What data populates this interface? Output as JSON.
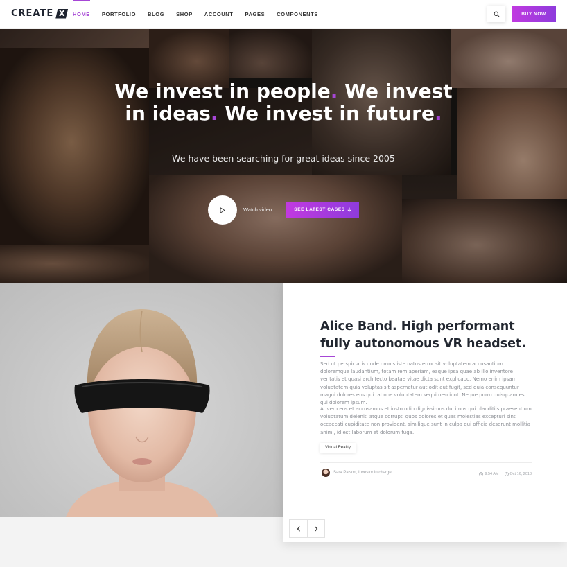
{
  "brand": {
    "name": "CREATE",
    "mark": "X"
  },
  "nav": [
    {
      "label": "HOME"
    },
    {
      "label": "PORTFOLIO"
    },
    {
      "label": "BLOG"
    },
    {
      "label": "SHOP"
    },
    {
      "label": "ACCOUNT"
    },
    {
      "label": "PAGES"
    },
    {
      "label": "COMPONENTS"
    }
  ],
  "header": {
    "buy_label": "BUY NOW",
    "search_icon": "search-icon"
  },
  "hero": {
    "title_part1": "We invest in people",
    "title_part2": " We invest in ideas",
    "title_part3": " We invest in future",
    "dot": ".",
    "subtitle": "We have been searching for great ideas since 2005",
    "watch_label": "Watch video",
    "cases_label": "SEE LATEST CASES",
    "cases_icon": "arrow-down-icon",
    "play_icon": "play-icon"
  },
  "article": {
    "title": "Alice Band. High performant fully autonomous VR headset.",
    "paragraph1": "Sed ut perspiciatis unde omnis iste natus error sit voluptatem accusantium doloremque laudantium, totam rem aperiam, eaque ipsa quae ab illo inventore veritatis et quasi architecto beatae vitae dicta sunt explicabo. Nemo enim ipsam voluptatem quia voluptas sit aspernatur aut odit aut fugit, sed quia consequuntur magni dolores eos qui ratione voluptatem sequi nesciunt. Neque porro quisquam est, qui dolorem ipsum.",
    "paragraph2": "At vero eos et accusamus et iusto odio dignissimos ducimus qui blanditiis praesentium voluptatum deleniti atque corrupti quos dolores et quas molestias excepturi sint occaecati cupiditate non provident, similique sunt in culpa qui officia deserunt mollitia animi, id est laborum et dolorum fuga.",
    "tag": "Virtual Reality",
    "author": "Sara Palson, Investor in charge",
    "time": "9:54 AM",
    "date": "Oct 16, 2018"
  },
  "colors": {
    "accent": "#a646d6",
    "dark": "#222730"
  }
}
